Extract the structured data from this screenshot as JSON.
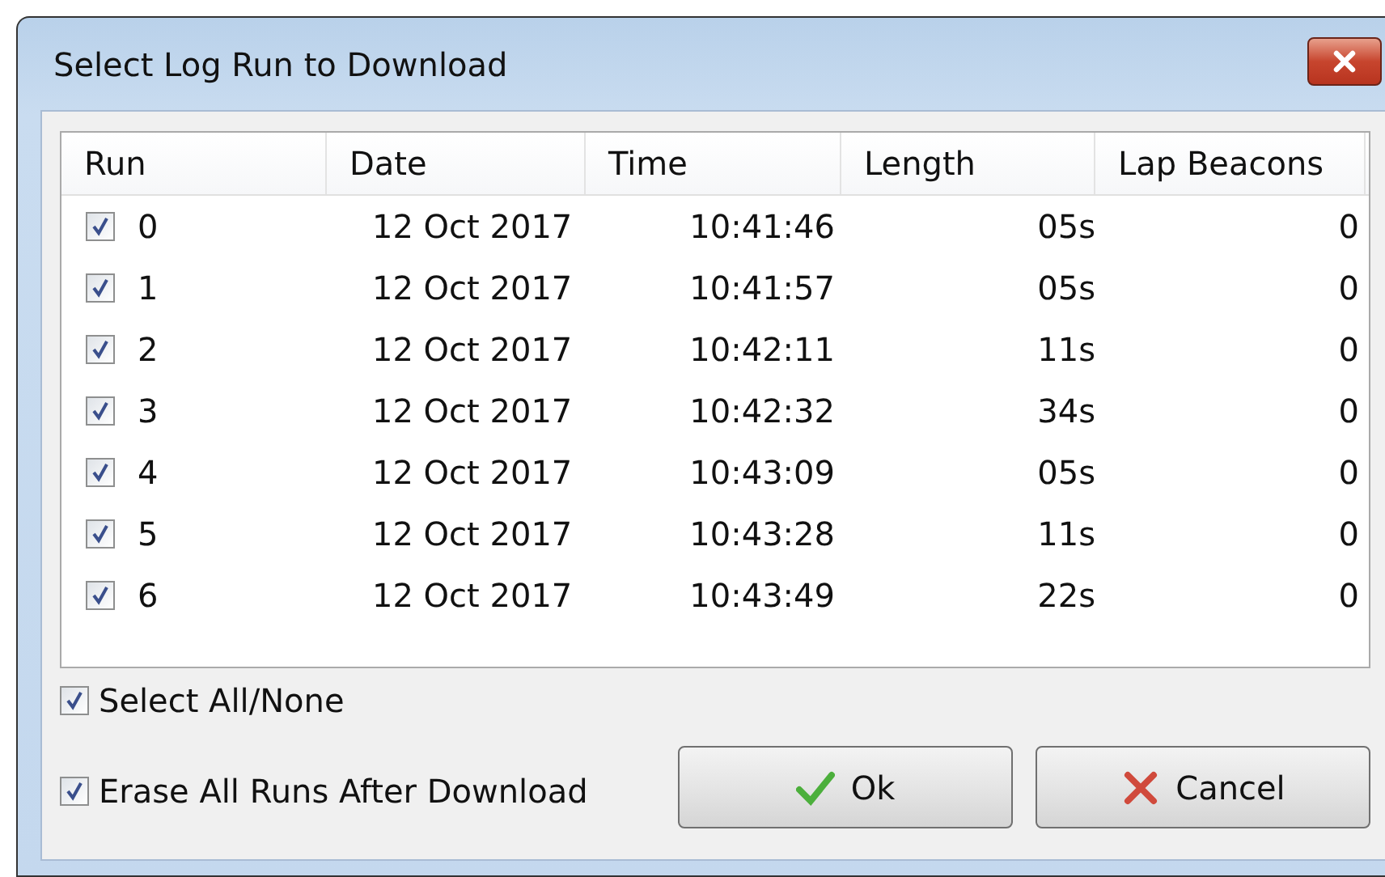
{
  "window": {
    "title": "Select Log Run to Download"
  },
  "table": {
    "columns": [
      "Run",
      "Date",
      "Time",
      "Length",
      "Lap Beacons"
    ],
    "rows": [
      {
        "checked": true,
        "run": "0",
        "date": "12 Oct 2017",
        "time": "10:41:46",
        "length": "05s",
        "lap_beacons": "0"
      },
      {
        "checked": true,
        "run": "1",
        "date": "12 Oct 2017",
        "time": "10:41:57",
        "length": "05s",
        "lap_beacons": "0"
      },
      {
        "checked": true,
        "run": "2",
        "date": "12 Oct 2017",
        "time": "10:42:11",
        "length": "11s",
        "lap_beacons": "0"
      },
      {
        "checked": true,
        "run": "3",
        "date": "12 Oct 2017",
        "time": "10:42:32",
        "length": "34s",
        "lap_beacons": "0"
      },
      {
        "checked": true,
        "run": "4",
        "date": "12 Oct 2017",
        "time": "10:43:09",
        "length": "05s",
        "lap_beacons": "0"
      },
      {
        "checked": true,
        "run": "5",
        "date": "12 Oct 2017",
        "time": "10:43:28",
        "length": "11s",
        "lap_beacons": "0"
      },
      {
        "checked": true,
        "run": "6",
        "date": "12 Oct 2017",
        "time": "10:43:49",
        "length": "22s",
        "lap_beacons": "0"
      }
    ]
  },
  "options": [
    {
      "label": "Select All/None",
      "checked": true
    },
    {
      "label": "Erase All Runs After Download",
      "checked": true
    }
  ],
  "buttons": [
    {
      "kind": "ok",
      "label": "Ok"
    },
    {
      "kind": "cancel",
      "label": "Cancel"
    }
  ]
}
